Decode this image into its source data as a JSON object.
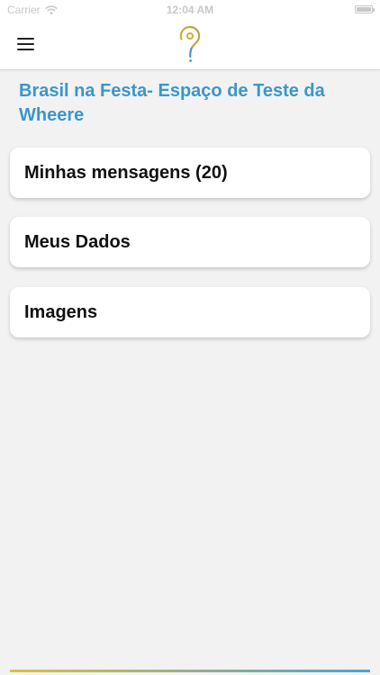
{
  "status_bar": {
    "carrier": "Carrier",
    "time": "12:04 AM",
    "wifi_icon": "wifi-icon",
    "battery_icon": "battery-icon"
  },
  "nav": {
    "menu_icon": "hamburger-menu-icon",
    "logo": "map-pin-logo"
  },
  "title": "Brasil na Festa- Espaço de Teste da Wheere",
  "menu_items": [
    {
      "label": "Minhas mensagens (20)"
    },
    {
      "label": "Meus Dados"
    },
    {
      "label": "Imagens"
    }
  ],
  "colors": {
    "title": "#3a97c9",
    "background": "#f2f2f2",
    "logo_gold": "#c9b03f",
    "logo_blue": "#4a95c4"
  }
}
